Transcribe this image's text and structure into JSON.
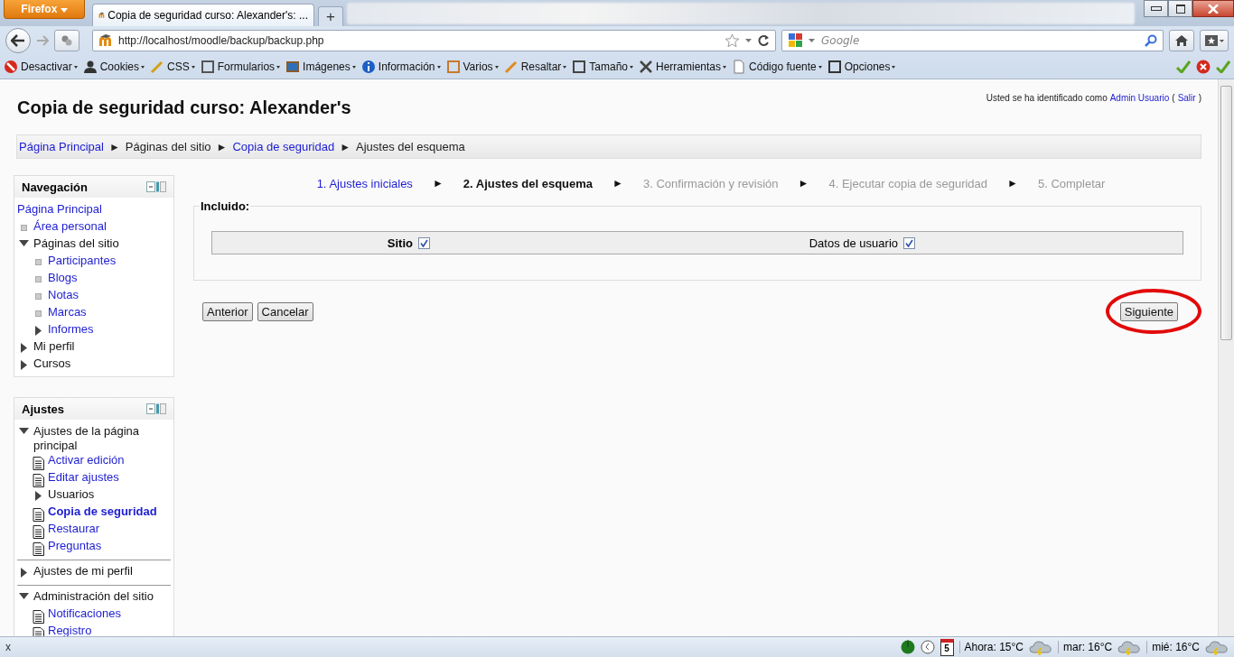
{
  "browser": {
    "app_button": "Firefox",
    "tab_title": "Copia de seguridad curso: Alexander's: ...",
    "new_tab": "+",
    "url": "http://localhost/moodle/backup/backup.php",
    "search": {
      "placeholder": "Google"
    },
    "toolbar": [
      "Desactivar",
      "Cookies",
      "CSS",
      "Formularios",
      "Imágenes",
      "Información",
      "Varios",
      "Resaltar",
      "Tamaño",
      "Herramientas",
      "Código fuente",
      "Opciones"
    ]
  },
  "page": {
    "login": {
      "prefix": "Usted se ha identificado como",
      "user": "Admin Usuario",
      "open": "(",
      "logout": "Salir",
      "close": ")"
    },
    "heading": "Copia de seguridad curso: Alexander's",
    "breadcrumb": {
      "separator": "►",
      "items": [
        {
          "label": "Página Principal",
          "kind": "link"
        },
        {
          "label": "Páginas del sitio",
          "kind": "text"
        },
        {
          "label": "Copia de seguridad",
          "kind": "link"
        },
        {
          "label": "Ajustes del esquema",
          "kind": "text"
        }
      ]
    },
    "blocks": [
      {
        "title": "Navegación",
        "divided": false,
        "items": [
          {
            "label": "Página Principal",
            "kind": "plain",
            "link": true,
            "selected": false
          },
          {
            "label": "Área personal",
            "kind": "bullet",
            "link": true,
            "selected": false
          },
          {
            "label": "Páginas del sitio",
            "kind": "expanded",
            "link": false,
            "selected": false,
            "children": [
              {
                "label": "Participantes",
                "kind": "bullet",
                "link": true,
                "selected": false
              },
              {
                "label": "Blogs",
                "kind": "bullet",
                "link": true,
                "selected": false
              },
              {
                "label": "Notas",
                "kind": "bullet",
                "link": true,
                "selected": false
              },
              {
                "label": "Marcas",
                "kind": "bullet",
                "link": true,
                "selected": false
              },
              {
                "label": "Informes",
                "kind": "collapsed",
                "link": true,
                "selected": false
              }
            ]
          },
          {
            "label": "Mi perfil",
            "kind": "collapsed",
            "link": false,
            "selected": false
          },
          {
            "label": "Cursos",
            "kind": "collapsed",
            "link": false,
            "selected": false
          }
        ]
      },
      {
        "title": "Ajustes",
        "divided": true,
        "items": [
          {
            "label": "Ajustes de la página principal",
            "kind": "expanded",
            "link": false,
            "selected": false,
            "children": [
              {
                "label": "Activar edición",
                "kind": "icon",
                "link": true,
                "selected": false
              },
              {
                "label": "Editar ajustes",
                "kind": "icon",
                "link": true,
                "selected": false
              },
              {
                "label": "Usuarios",
                "kind": "collapsed",
                "link": false,
                "selected": false
              },
              {
                "label": "Copia de seguridad",
                "kind": "icon",
                "link": true,
                "selected": true
              },
              {
                "label": "Restaurar",
                "kind": "icon",
                "link": true,
                "selected": false
              },
              {
                "label": "Preguntas",
                "kind": "icon",
                "link": true,
                "selected": false
              }
            ]
          },
          {
            "label": "Ajustes de mi perfil",
            "kind": "collapsed",
            "link": false,
            "selected": false
          },
          {
            "label": "Administración del sitio",
            "kind": "expanded",
            "link": false,
            "selected": false,
            "children": [
              {
                "label": "Notificaciones",
                "kind": "icon",
                "link": true,
                "selected": false
              },
              {
                "label": "Registro",
                "kind": "icon",
                "link": true,
                "selected": false
              }
            ]
          }
        ]
      }
    ],
    "steps": {
      "separator": "►",
      "items": [
        {
          "label": "1. Ajustes iniciales",
          "kind": "done"
        },
        {
          "label": "2. Ajustes del esquema",
          "kind": "current"
        },
        {
          "label": "3. Confirmación y revisión",
          "kind": "future"
        },
        {
          "label": "4. Ejecutar copia de seguridad",
          "kind": "future"
        },
        {
          "label": "5. Completar",
          "kind": "future"
        }
      ]
    },
    "fieldset": {
      "legend": "Incluido:",
      "settings": [
        {
          "label": "Sitio",
          "kind": "primary",
          "checked": true
        },
        {
          "label": "Datos de usuario",
          "kind": "secondary",
          "checked": true
        }
      ]
    },
    "buttons": [
      {
        "label": "Anterior",
        "highlighted": false
      },
      {
        "label": "Cancelar",
        "highlighted": false
      },
      {
        "label": "Siguiente",
        "highlighted": true
      }
    ]
  },
  "status_bar": {
    "close": "x",
    "calendar_day": "5",
    "weather": [
      "Ahora: 15°C",
      "mar: 16°C",
      "mié: 16°C"
    ]
  }
}
